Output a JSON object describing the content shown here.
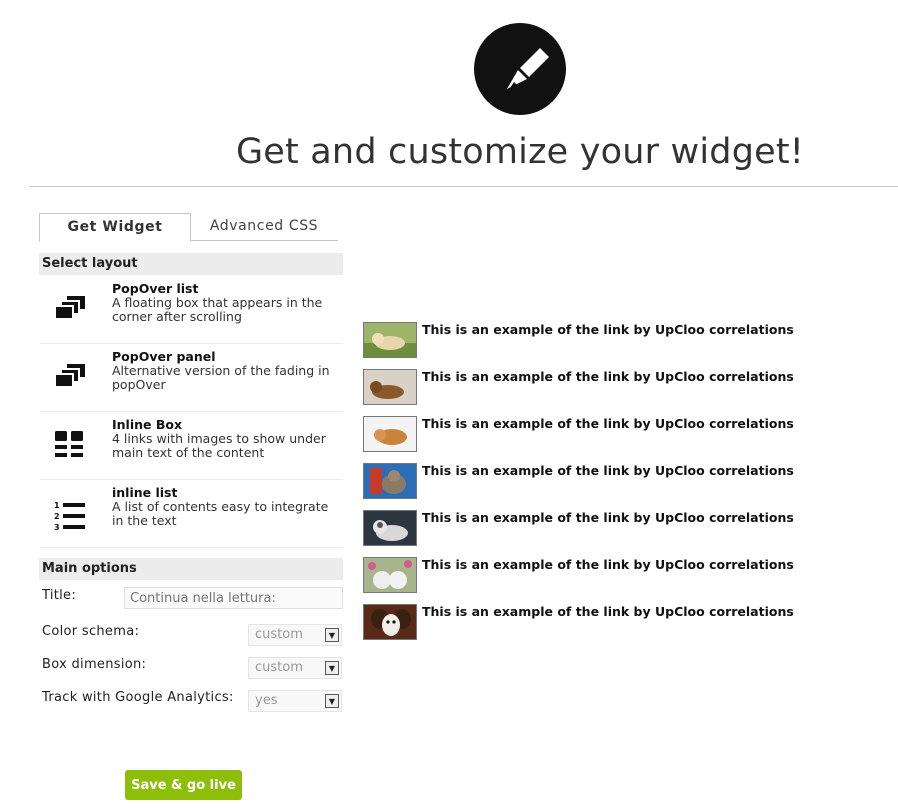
{
  "header": {
    "title": "Get and customize your widget!"
  },
  "tabs": [
    {
      "label": "Get Widget",
      "active": true
    },
    {
      "label": "Advanced CSS",
      "active": false
    }
  ],
  "layout_section": {
    "heading": "Select layout",
    "items": [
      {
        "title": "PopOver list",
        "description": "A floating box that appears in the corner after scrolling",
        "icon": "stacked-windows-icon"
      },
      {
        "title": "PopOver panel",
        "description": "Alternative version of the fading in popOver",
        "icon": "stacked-windows-icon"
      },
      {
        "title": "Inline Box",
        "description": "4 links with images to show under main text of the content",
        "icon": "grid-list-icon"
      },
      {
        "title": "inline list",
        "description": "A list of contents easy to integrate in the text",
        "icon": "numbered-list-icon"
      }
    ]
  },
  "options_section": {
    "heading": "Main options",
    "title_label": "Title:",
    "title_placeholder": "Continua nella lettura:",
    "color_label": "Color schema:",
    "color_value": "custom",
    "box_label": "Box dimension:",
    "box_value": "custom",
    "track_label": "Track with Google Analytics:",
    "track_value": "yes"
  },
  "save_button": {
    "label": "Save & go live",
    "color": "#8cbe0a"
  },
  "preview": {
    "links": [
      {
        "text": "This is an example of the link by UpCloo correlations",
        "thumb": "puppy-on-grass"
      },
      {
        "text": "This is an example of the link by UpCloo correlations",
        "thumb": "dog-lying"
      },
      {
        "text": "This is an example of the link by UpCloo correlations",
        "thumb": "puppy-white-background"
      },
      {
        "text": "This is an example of the link by UpCloo correlations",
        "thumb": "cat-blue-background"
      },
      {
        "text": "This is an example of the link by UpCloo correlations",
        "thumb": "husky-dog"
      },
      {
        "text": "This is an example of the link by UpCloo correlations",
        "thumb": "puppies-flowers"
      },
      {
        "text": "This is an example of the link by UpCloo correlations",
        "thumb": "papillon-dog"
      }
    ]
  }
}
